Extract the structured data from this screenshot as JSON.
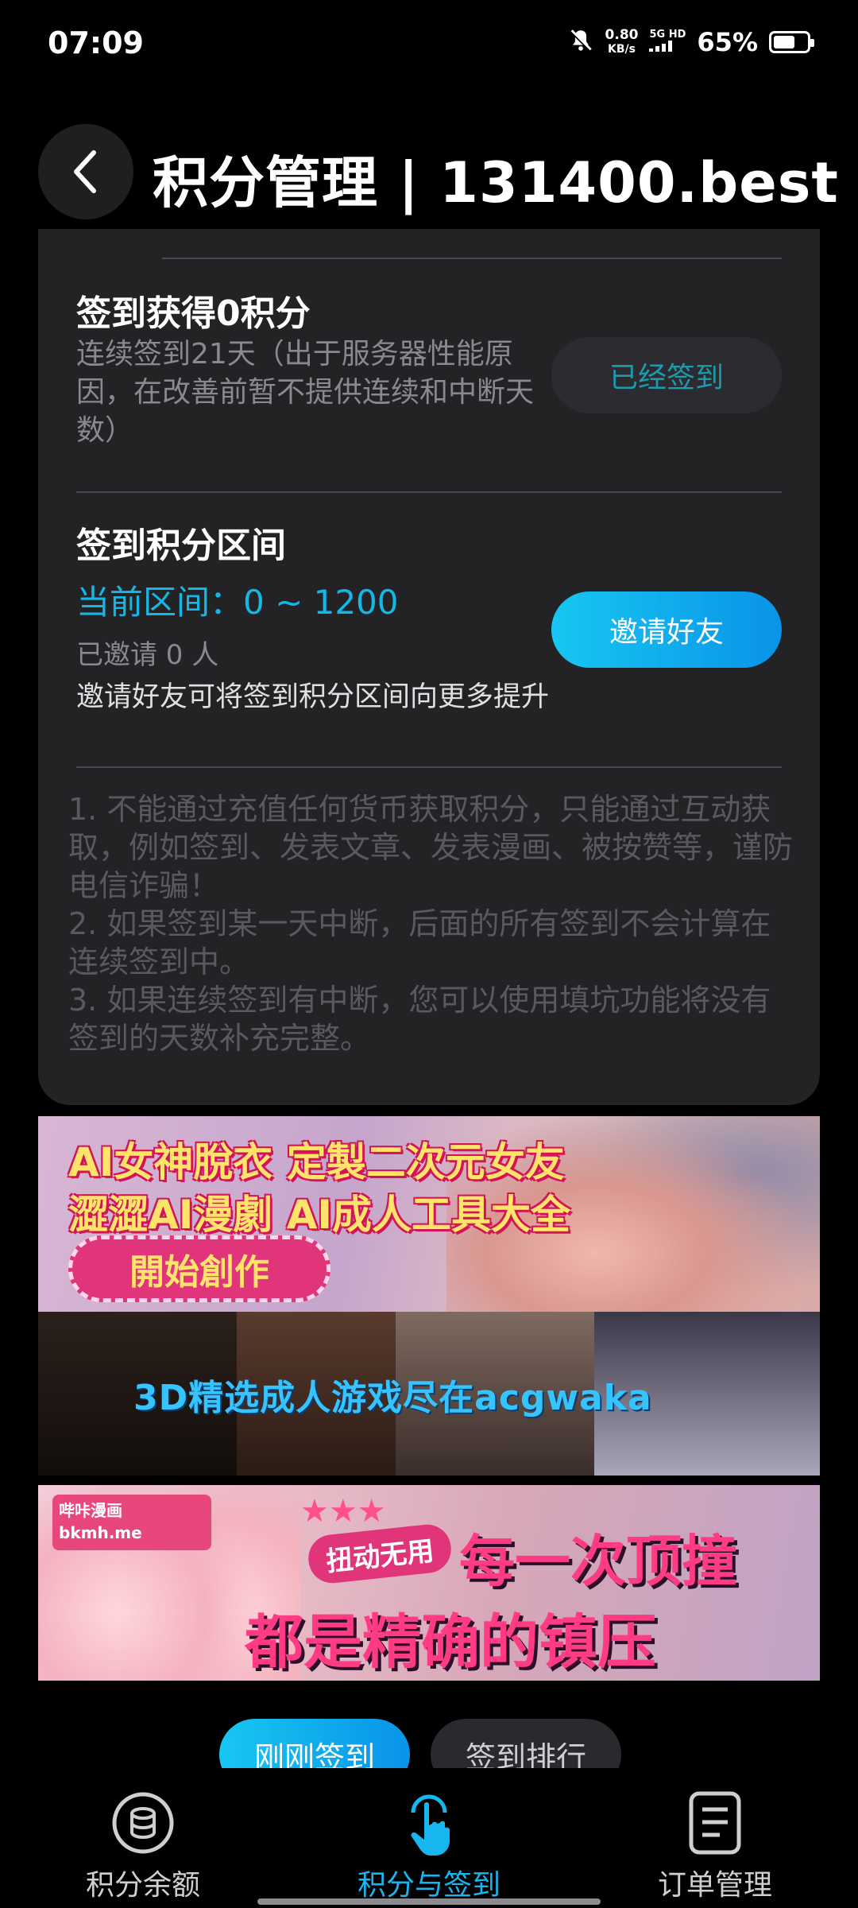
{
  "status_bar": {
    "time": "07:09",
    "net_speed": "0.80",
    "net_speed_unit": "KB/s",
    "net_type": "5G HD",
    "battery_percent": "65%",
    "battery_level": 0.65
  },
  "header": {
    "title": "积分管理 | 131400.best"
  },
  "checkin": {
    "title": "签到获得0积分",
    "description": "连续签到21天（出于服务器性能原因，在改善前暂不提供连续和中断天数）",
    "button_label": "已经签到"
  },
  "range": {
    "title": "签到积分区间",
    "current": "当前区间：0 ~ 1200",
    "invited": "已邀请 0 人",
    "hint": "邀请好友可将签到积分区间向更多提升",
    "button_label": "邀请好友"
  },
  "rules": [
    "1. 不能通过充值任何货币获取积分，只能通过互动获取，例如签到、发表文章、发表漫画、被按赞等，谨防电信诈骗！",
    "2. 如果签到某一天中断，后面的所有签到不会计算在连续签到中。",
    "3. 如果连续签到有中断，您可以使用填坑功能将没有签到的天数补充完整。"
  ],
  "banners": {
    "b1_line1": "AI女神脫衣  定製二次元女友",
    "b1_line2": "澀澀AI漫劇  AI成人工具大全",
    "b1_cta": "開始創作",
    "b2_text": "3D精选成人游戏尽在acgwaka",
    "b3_logo": "哔咔漫画 bkmh.me",
    "b3_badge": "扭动无用",
    "b3_line1": "每一次顶撞",
    "b3_line2": "都是精确的镇压"
  },
  "float_tabs": {
    "active": "刚刚签到",
    "inactive": "签到排行"
  },
  "bottom_nav": [
    {
      "label": "积分余额",
      "icon": "coins-icon"
    },
    {
      "label": "积分与签到",
      "icon": "tap-hand-icon"
    },
    {
      "label": "订单管理",
      "icon": "order-list-icon"
    }
  ],
  "colors": {
    "accent": "#17b6ee",
    "card_bg": "#232326",
    "muted_text": "#8a8a8e"
  }
}
